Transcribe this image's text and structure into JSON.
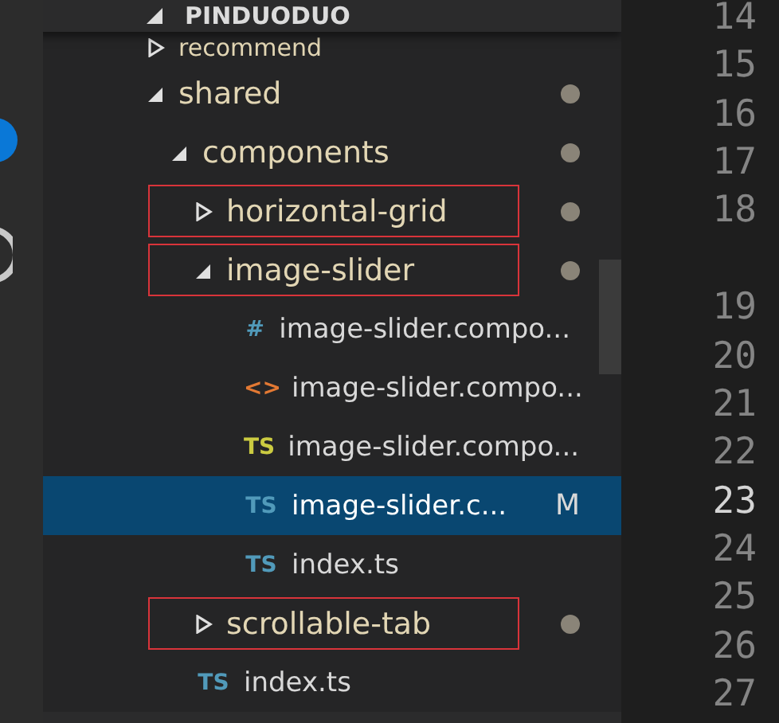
{
  "explorer": {
    "title": "PINDUODUO",
    "tree": [
      {
        "kind": "folder",
        "label": "recommend",
        "expanded": false,
        "modified": false,
        "annotated": false
      },
      {
        "kind": "folder",
        "label": "shared",
        "expanded": true,
        "modified": true,
        "annotated": false,
        "children": [
          {
            "kind": "folder",
            "label": "components",
            "expanded": true,
            "modified": true,
            "annotated": false,
            "children": [
              {
                "kind": "folder",
                "label": "horizontal-grid",
                "expanded": false,
                "modified": true,
                "annotated": true
              },
              {
                "kind": "folder",
                "label": "image-slider",
                "expanded": true,
                "modified": true,
                "annotated": true,
                "children": [
                  {
                    "kind": "file",
                    "icon_label": "#",
                    "color": "#519aba",
                    "label": "image-slider.compo...",
                    "selected": false
                  },
                  {
                    "kind": "file",
                    "icon_label": "<>",
                    "color": "#e37933",
                    "label": "image-slider.compo...",
                    "selected": false
                  },
                  {
                    "kind": "file",
                    "icon_label": "TS",
                    "color": "#cbcb41",
                    "label": "image-slider.compo...",
                    "selected": false
                  },
                  {
                    "kind": "file",
                    "icon_label": "TS",
                    "color": "#519aba",
                    "label": "image-slider.c...",
                    "selected": true,
                    "badge": "M"
                  },
                  {
                    "kind": "file",
                    "icon_label": "TS",
                    "color": "#519aba",
                    "label": "index.ts",
                    "selected": false
                  }
                ]
              },
              {
                "kind": "folder",
                "label": "scrollable-tab",
                "expanded": false,
                "modified": true,
                "annotated": true
              }
            ]
          },
          {
            "kind": "file",
            "icon_label": "TS",
            "color": "#519aba",
            "label": "index.ts",
            "selected": false
          }
        ]
      }
    ]
  },
  "gutter": [
    {
      "kind": "line",
      "number": "14",
      "current": false
    },
    {
      "kind": "line",
      "number": "15",
      "current": false
    },
    {
      "kind": "line",
      "number": "16",
      "current": false
    },
    {
      "kind": "line",
      "number": "17",
      "current": false
    },
    {
      "kind": "line",
      "number": "18",
      "current": false
    },
    {
      "kind": "continuation"
    },
    {
      "kind": "line",
      "number": "19",
      "current": false
    },
    {
      "kind": "line",
      "number": "20",
      "current": false
    },
    {
      "kind": "line",
      "number": "21",
      "current": false
    },
    {
      "kind": "line",
      "number": "22",
      "current": false
    },
    {
      "kind": "line",
      "number": "23",
      "current": true
    },
    {
      "kind": "line",
      "number": "24",
      "current": false
    },
    {
      "kind": "line",
      "number": "25",
      "current": false
    },
    {
      "kind": "line",
      "number": "26",
      "current": false
    },
    {
      "kind": "line",
      "number": "27",
      "current": false
    }
  ]
}
